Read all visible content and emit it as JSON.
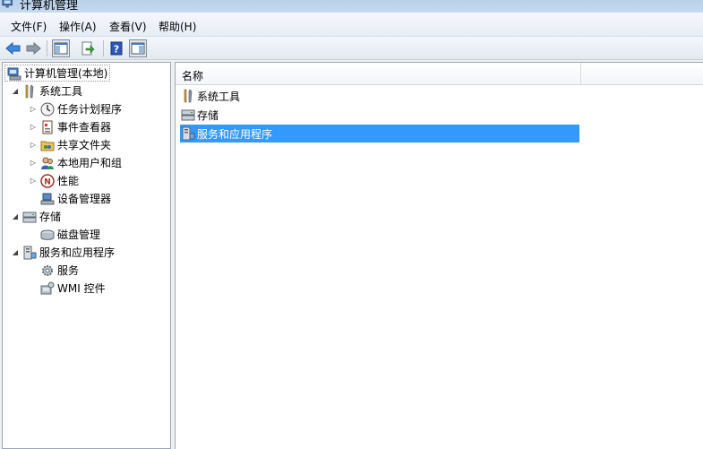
{
  "window": {
    "title": "计算机管理",
    "ghost_tabs": [
      "",
      ""
    ]
  },
  "menu": [
    "文件(F)",
    "操作(A)",
    "查看(V)",
    "帮助(H)"
  ],
  "toolbar": {
    "buttons": [
      "back-icon",
      "forward-icon",
      "show-hide-tree-icon",
      "export-list-icon",
      "help-icon",
      "show-hide-action-pane-icon"
    ]
  },
  "tree": {
    "root": "计算机管理(本地)",
    "items": [
      {
        "label": "系统工具",
        "icon": "tools-icon",
        "expanded": true
      },
      {
        "label": "任务计划程序",
        "icon": "clock-icon"
      },
      {
        "label": "事件查看器",
        "icon": "event-viewer-icon"
      },
      {
        "label": "共享文件夹",
        "icon": "shared-folder-icon"
      },
      {
        "label": "本地用户和组",
        "icon": "users-icon"
      },
      {
        "label": "性能",
        "icon": "performance-icon"
      },
      {
        "label": "设备管理器",
        "icon": "device-manager-icon"
      },
      {
        "label": "存储",
        "icon": "storage-icon",
        "expanded": true
      },
      {
        "label": "磁盘管理",
        "icon": "disk-icon"
      },
      {
        "label": "服务和应用程序",
        "icon": "services-apps-icon",
        "expanded": true
      },
      {
        "label": "服务",
        "icon": "gear-icon"
      },
      {
        "label": "WMI 控件",
        "icon": "wmi-icon"
      }
    ]
  },
  "list": {
    "column_name": "名称",
    "rows": [
      {
        "label": "系统工具",
        "icon": "tools-icon"
      },
      {
        "label": "存储",
        "icon": "storage-icon"
      },
      {
        "label": "服务和应用程序",
        "icon": "services-apps-icon",
        "selected": true
      }
    ]
  },
  "colors": {
    "selection": "#3399ff",
    "pane_border": "#9aa7b7"
  }
}
